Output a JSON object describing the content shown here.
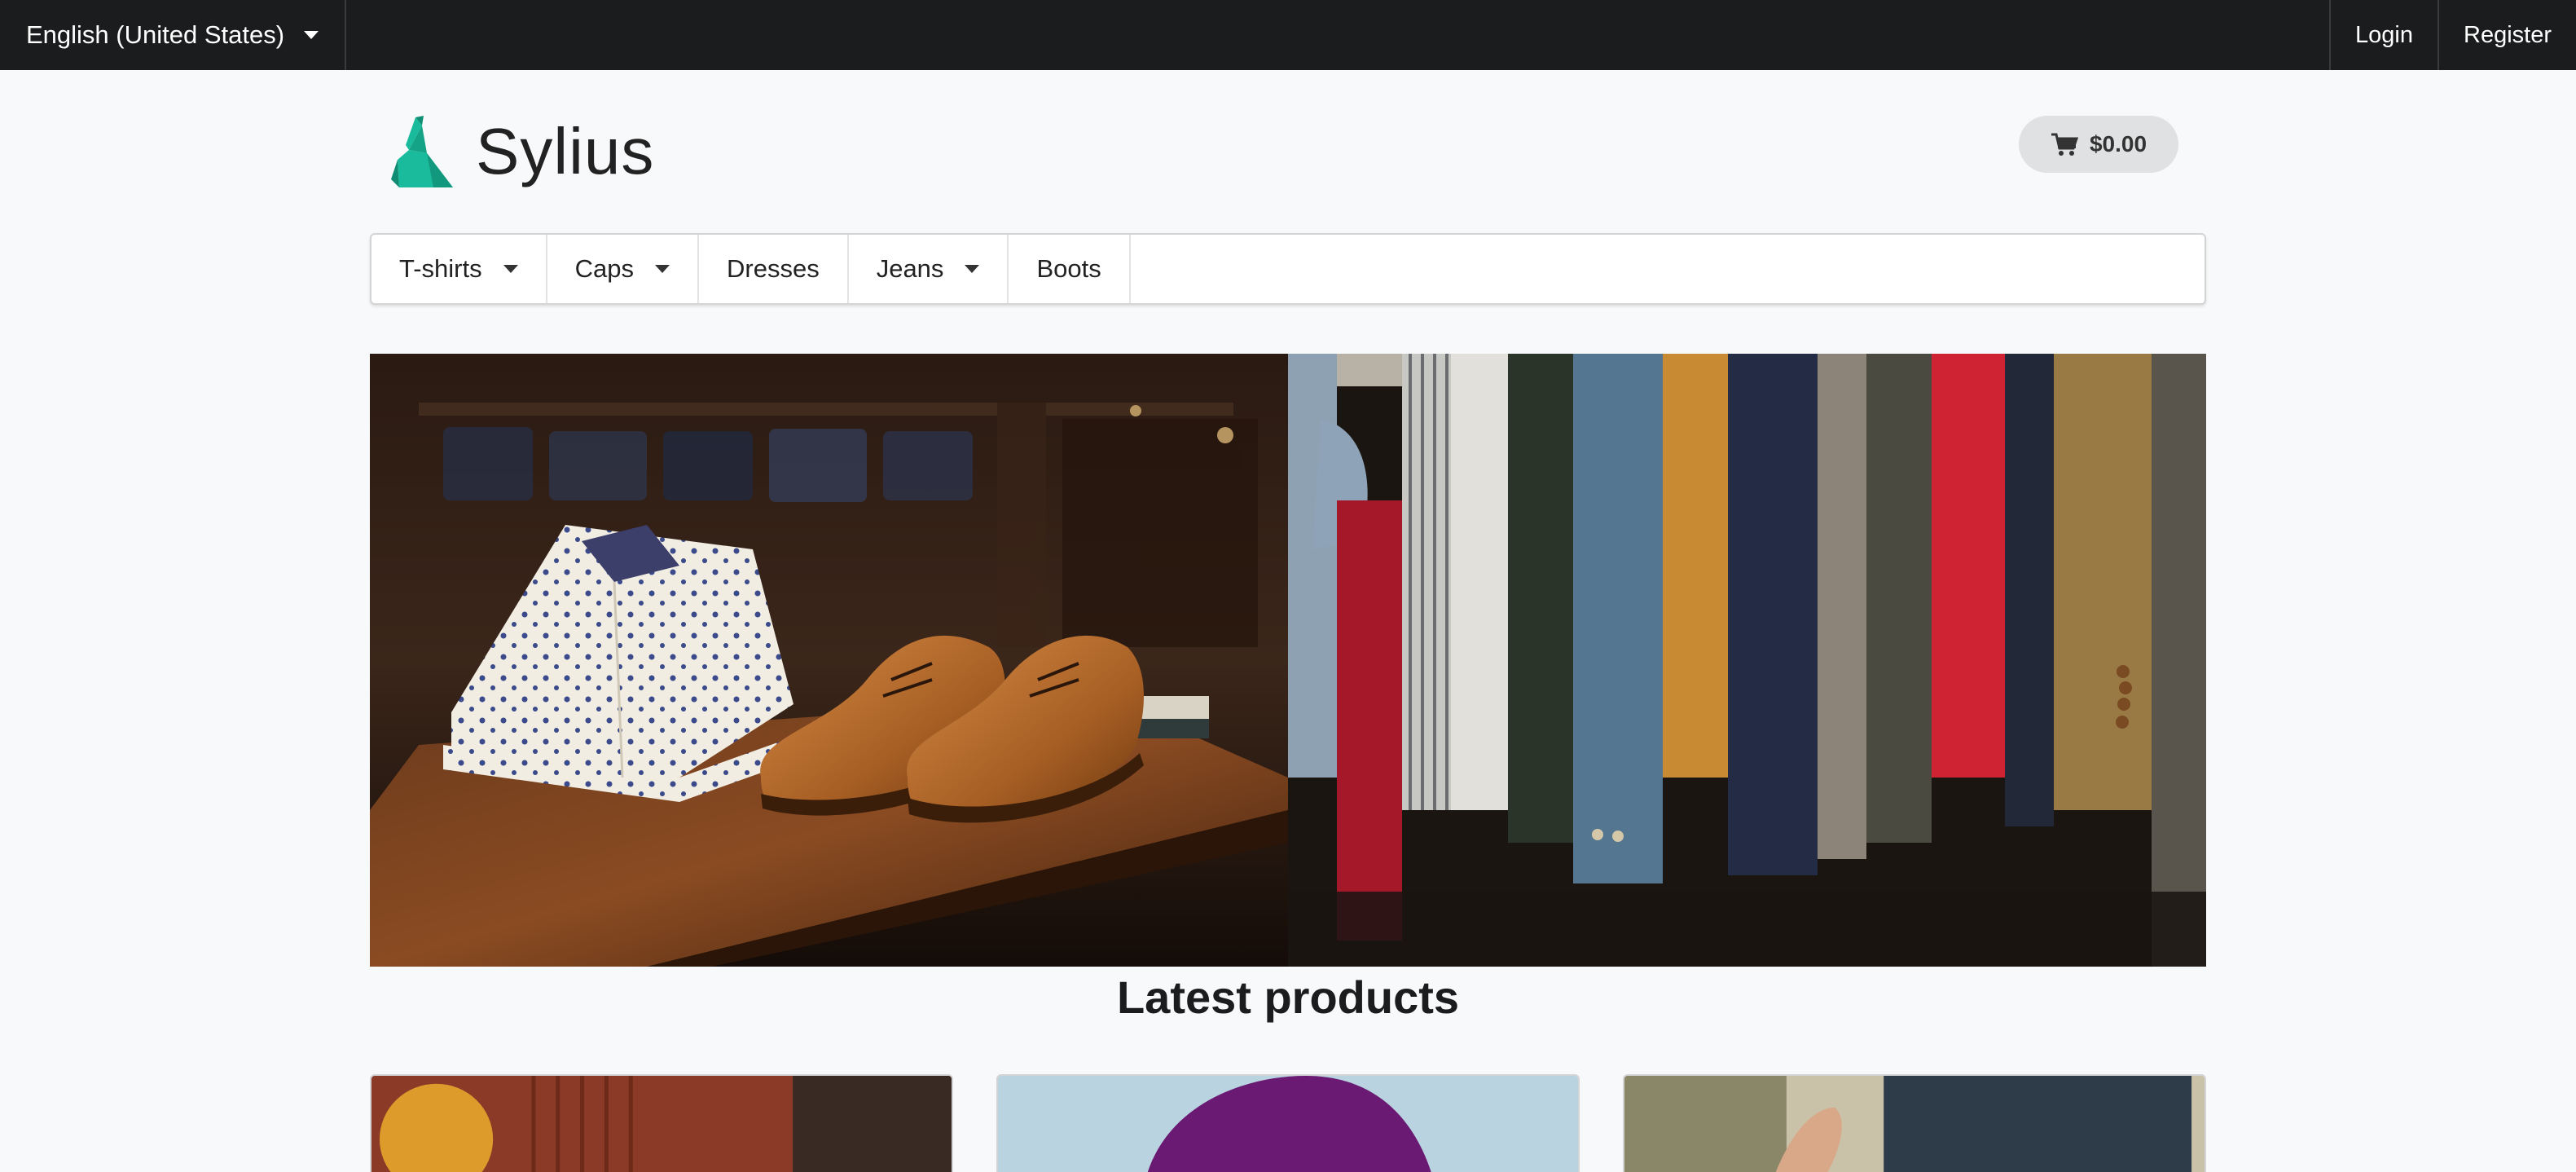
{
  "topbar": {
    "language": "English (United States)",
    "login": "Login",
    "register": "Register"
  },
  "header": {
    "brand": "Sylius",
    "cart_total": "$0.00"
  },
  "menu": {
    "items": [
      {
        "label": "T-shirts",
        "has_dropdown": true
      },
      {
        "label": "Caps",
        "has_dropdown": true
      },
      {
        "label": "Dresses",
        "has_dropdown": false
      },
      {
        "label": "Jeans",
        "has_dropdown": true
      },
      {
        "label": "Boots",
        "has_dropdown": false
      }
    ]
  },
  "main": {
    "section_title": "Latest products"
  },
  "icons": {
    "language_dropdown": "chevron-down-icon",
    "cart": "cart-icon",
    "logo": "sylius-swan-logo"
  },
  "colors": {
    "topbar_bg": "#1b1c1d",
    "page_bg": "#f7f9fa",
    "brand_green": "#1abb9c",
    "cart_bg": "#e0e1e2"
  }
}
